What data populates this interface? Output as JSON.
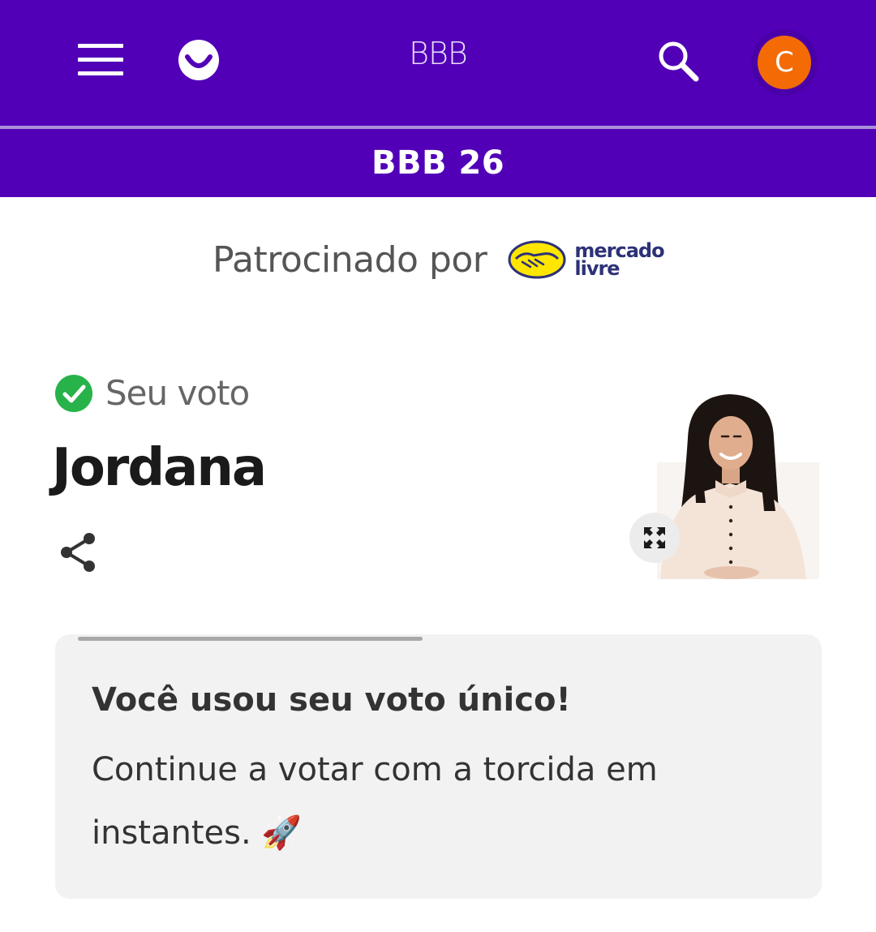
{
  "header": {
    "title": "BBB",
    "avatar_initial": "C",
    "menu_icon": "hamburger-menu-icon",
    "logo_icon": "smiley-logo-icon",
    "search_icon": "search-icon",
    "brand_color": "#5200b8",
    "avatar_color": "#f46b06"
  },
  "subheader": {
    "title": "BBB 26"
  },
  "sponsor": {
    "label": "Patrocinado por",
    "logo_text": "mercado livre",
    "logo_icon": "mercado-livre-handshake-logo"
  },
  "vote": {
    "status_label": "Seu voto",
    "status_icon": "check-circle-icon",
    "status_color": "#27b24a",
    "candidate_name": "Jordana",
    "share_icon": "share-icon",
    "expand_icon": "expand-icon"
  },
  "message_card": {
    "progress": 0.45,
    "title": "Você usou seu voto único!",
    "body": "Continue a votar com a torcida em instantes. 🚀"
  }
}
